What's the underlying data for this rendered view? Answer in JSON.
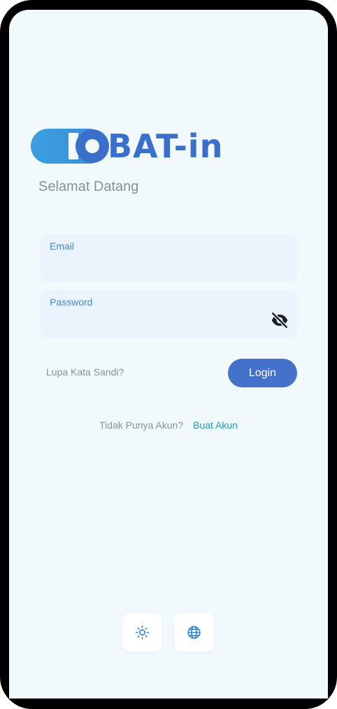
{
  "brand": {
    "logo_text": "BAT-in",
    "primary_color": "#3a6fcb",
    "secondary_color": "#3b9fe0"
  },
  "welcome_text": "Selamat Datang",
  "email_field": {
    "label": "Email",
    "value": ""
  },
  "password_field": {
    "label": "Password",
    "value": "",
    "visibility_icon": "eye-off-icon"
  },
  "forgot_password_label": "Lupa Kata Sandi?",
  "login_label": "Login",
  "signup": {
    "question": "Tidak Punya Akun?",
    "link_label": "Buat Akun"
  },
  "bottom_actions": {
    "theme_icon": "sun-icon",
    "language_icon": "globe-icon"
  },
  "colors": {
    "background": "#f2f9fd",
    "field_background": "#ebf4fc",
    "button": "#4471c9",
    "link": "#1e9ac9",
    "muted_text": "#8a8f96"
  }
}
